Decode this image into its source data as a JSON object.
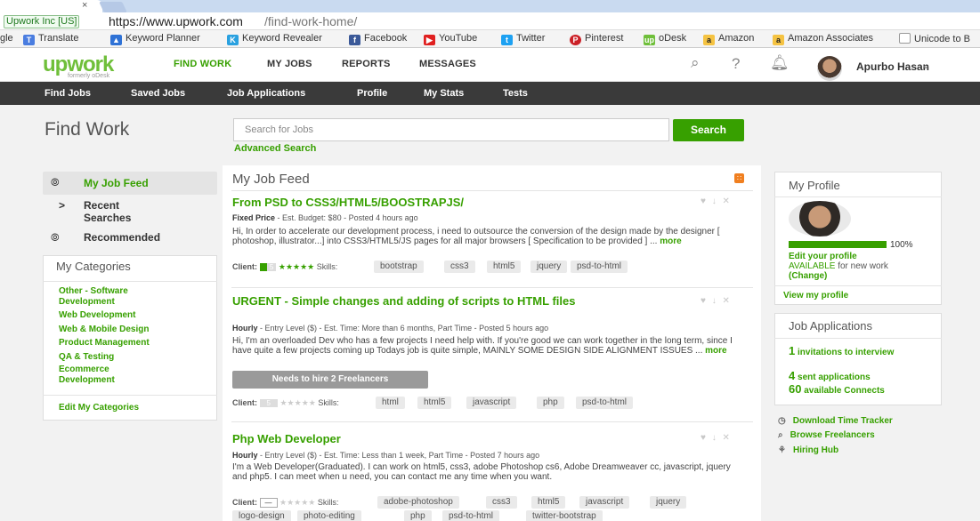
{
  "browser": {
    "tab_close": "×",
    "secure_label": "Upwork Inc [US]",
    "url_host": "https://www.upwork.com",
    "url_path": "/find-work-home/",
    "bookmarks": [
      "gle",
      "Translate",
      "Keyword Planner",
      "Keyword Revealer",
      "Facebook",
      "YouTube",
      "Twitter",
      "Pinterest",
      "oDesk",
      "Amazon",
      "Amazon Associates",
      "Unicode to B"
    ]
  },
  "header": {
    "logo": "upwork",
    "logo_sub": "formerly oDesk",
    "nav": [
      "FIND WORK",
      "MY JOBS",
      "REPORTS",
      "MESSAGES"
    ],
    "user_name": "Apurbo Hasan"
  },
  "subnav": [
    "Find Jobs",
    "Saved Jobs",
    "Job Applications",
    "Profile",
    "My Stats",
    "Tests"
  ],
  "page": {
    "title": "Find Work",
    "search_placeholder": "Search for Jobs",
    "search_button": "Search",
    "advanced_search": "Advanced Search"
  },
  "left": {
    "my_job_feed": "My Job Feed",
    "recent_searches": "Recent Searches",
    "recommended": "Recommended",
    "categories_title": "My Categories",
    "categories": [
      "Other - Software Development",
      "Web Development",
      "Web & Mobile Design",
      "Product Management",
      "QA & Testing",
      "Ecommerce Development"
    ],
    "edit_categories": "Edit My Categories"
  },
  "feed": {
    "title": "My Job Feed",
    "jobs": [
      {
        "title": "From PSD to CSS3/HTML5/BOOSTRAPJS/",
        "type": "Fixed Price",
        "meta": " - Est. Budget: $80 - Posted 4 hours ago",
        "description": "Hi, In order to accelerate our development process, i need to outsource the conversion of the design made by the designer [ photoshop, illustrator...] into CSS3/HTML5/JS pages for all major browsers [ Specification to be provided ] ... ",
        "more": "more",
        "client_label": "Client:",
        "client_badge": "5",
        "stars": "★★★★★",
        "skills_label": "Skills:",
        "skills": [
          "bootstrap",
          "css3",
          "html5",
          "jquery",
          "psd-to-html"
        ]
      },
      {
        "title": "URGENT - Simple changes and adding of scripts to HTML files",
        "type": "Hourly",
        "meta": " - Entry Level ($) - Est. Time: More than 6 months, Part Time - Posted 5 hours ago",
        "description": "Hi, I'm an overloaded Dev who has a few projects I need help with. If you're good we can work together in the long term, since I have quite a few projects coming up Todays job is quite simple, MAINLY SOME DESIGN SIDE ALIGNMENT ISSUES ... ",
        "more": "more",
        "hire": "Needs to hire 2 Freelancers",
        "client_label": "Client:",
        "client_badge": "5",
        "stars": "★★★★★",
        "skills_label": "Skills:",
        "skills": [
          "html",
          "html5",
          "javascript",
          "php",
          "psd-to-html"
        ]
      },
      {
        "title": "Php Web Developer",
        "type": "Hourly",
        "meta": " - Entry Level ($) - Est. Time: Less than 1 week, Part Time - Posted 7 hours ago",
        "description": "I'm a Web Developer(Graduated). I can work on html5, css3, adobe Photoshop cs6, Adobe Dreamweaver cc, javascript, jquery and php5. I can meet when u need, you can contact me any time when you want.",
        "client_label": "Client:",
        "client_badge": "—",
        "stars": "★★★★★",
        "skills_label": "Skills:",
        "skills": [
          "adobe-photoshop",
          "css3",
          "html5",
          "javascript",
          "jquery",
          "logo-design",
          "photo-editing",
          "php",
          "psd-to-html",
          "twitter-bootstrap"
        ]
      }
    ]
  },
  "right": {
    "profile_title": "My Profile",
    "profile_pct": "100%",
    "profile_completion": 1.0,
    "edit_profile": "Edit your profile",
    "available": "AVAILABLE",
    "available_rest": " for new work",
    "change": "(Change)",
    "view_profile": "View my profile",
    "applications_title": "Job Applications",
    "invitations_num": "1",
    "invitations_text": " invitations to interview",
    "sent_num": "4",
    "sent_text": " sent applications",
    "connects_num": "60",
    "connects_text": " available Connects",
    "tools": [
      "Download Time Tracker",
      "Browse Freelancers",
      "Hiring Hub"
    ]
  },
  "colors": {
    "brand": "#37a000",
    "subnav": "#3a3a3a"
  }
}
